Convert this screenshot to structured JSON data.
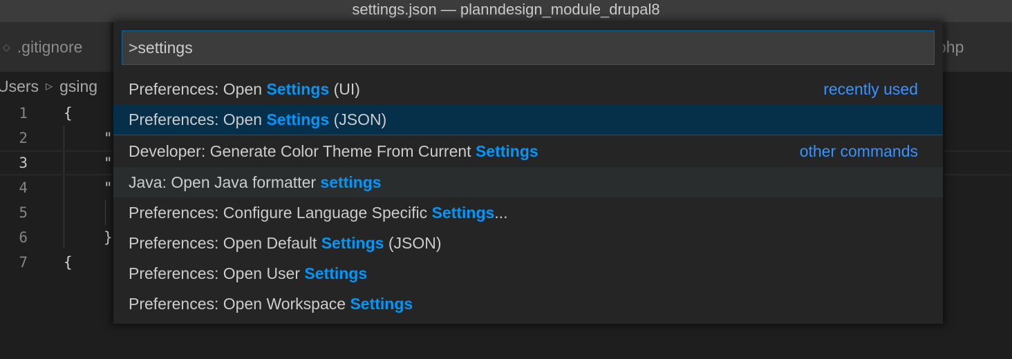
{
  "window": {
    "title": "settings.json — planndesign_module_drupal8"
  },
  "tabs": [
    {
      "label": ".gitignore",
      "icon": "file-icon"
    },
    {
      "label": "php"
    }
  ],
  "breadcrumb": {
    "first": "Users",
    "second": "gsing"
  },
  "editor": {
    "lines": [
      {
        "number": "1",
        "code": "{"
      },
      {
        "number": "2",
        "code": "\""
      },
      {
        "number": "3",
        "code": "\""
      },
      {
        "number": "4",
        "code": "\""
      },
      {
        "number": "5",
        "code": ""
      },
      {
        "number": "6",
        "code": "}"
      },
      {
        "number": "7",
        "code": "{"
      }
    ]
  },
  "palette": {
    "input_value": ">settings",
    "items": [
      {
        "pre": "Preferences: Open ",
        "match": "Settings",
        "post": " (UI)",
        "group": "recently used"
      },
      {
        "pre": "Preferences: Open ",
        "match": "Settings",
        "post": " (JSON)",
        "group": ""
      },
      {
        "pre": "Developer: Generate Color Theme From Current ",
        "match": "Settings",
        "post": "",
        "group": "other commands"
      },
      {
        "pre": "Java: Open Java formatter ",
        "match": "settings",
        "post": "",
        "group": ""
      },
      {
        "pre": "Preferences: Configure Language Specific ",
        "match": "Settings",
        "post": "...",
        "group": ""
      },
      {
        "pre": "Preferences: Open Default ",
        "match": "Settings",
        "post": " (JSON)",
        "group": ""
      },
      {
        "pre": "Preferences: Open User ",
        "match": "Settings",
        "post": "",
        "group": ""
      },
      {
        "pre": "Preferences: Open Workspace ",
        "match": "Settings",
        "post": "",
        "group": ""
      }
    ]
  },
  "colors": {
    "highlight": "#0097fb",
    "group_label": "#3794ff",
    "focused_row": "#062f4a",
    "input_border": "#0e639c"
  }
}
